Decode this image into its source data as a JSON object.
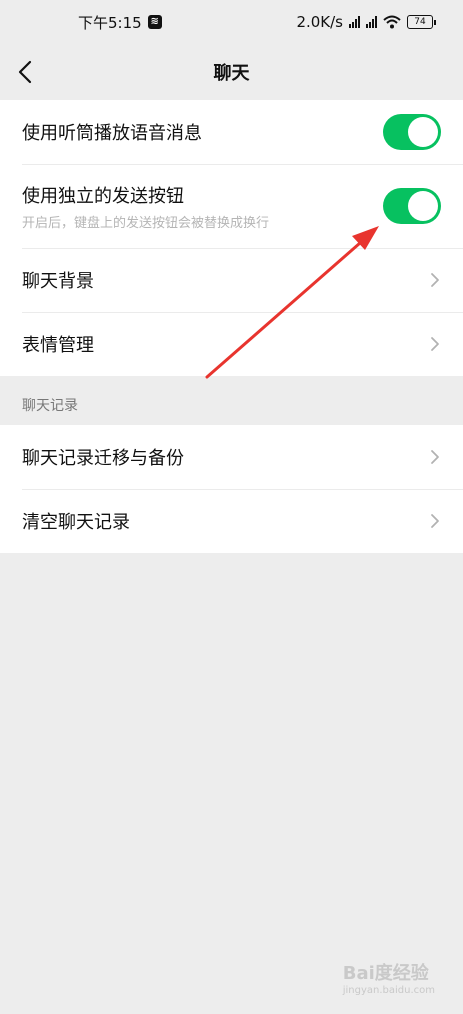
{
  "status": {
    "time": "下午5:15",
    "network_speed": "2.0K/s",
    "battery": "74"
  },
  "nav": {
    "title": "聊天"
  },
  "settings": {
    "earpiece_label": "使用听筒播放语音消息",
    "earpiece_on": true,
    "send_button_label": "使用独立的发送按钮",
    "send_button_desc": "开启后，键盘上的发送按钮会被替换成换行",
    "send_button_on": true,
    "background_label": "聊天背景",
    "sticker_label": "表情管理"
  },
  "history": {
    "header": "聊天记录",
    "migrate_label": "聊天记录迁移与备份",
    "clear_label": "清空聊天记录"
  },
  "watermark": {
    "brand": "Bai度经验",
    "url": "jingyan.baidu.com"
  },
  "colors": {
    "accent": "#07c160",
    "annotation_arrow": "#e8342e"
  }
}
